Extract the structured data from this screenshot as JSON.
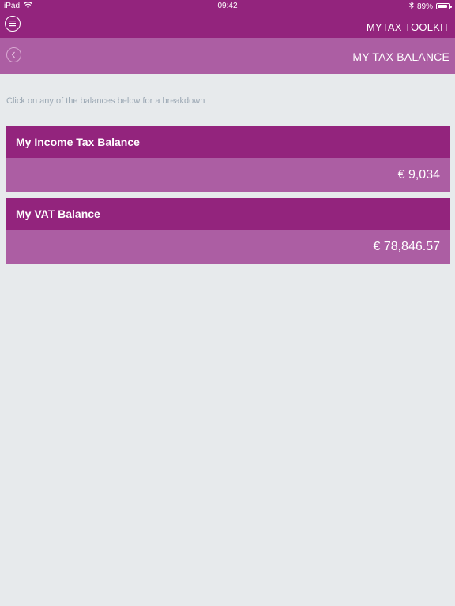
{
  "status_bar": {
    "device": "iPad",
    "time": "09:42",
    "battery": "89%",
    "battery_level": 0.89
  },
  "header": {
    "app_title": "MYTAX TOOLKIT",
    "menu_icon": "hamburger-menu-icon"
  },
  "subheader": {
    "page_title": "MY TAX BALANCE",
    "back_icon": "chevron-left-icon"
  },
  "hint": "Click on any of the balances below for a breakdown",
  "balances": [
    {
      "title": "My Income Tax Balance",
      "amount": "€ 9,034"
    },
    {
      "title": "My VAT Balance",
      "amount": "€ 78,846.57"
    }
  ],
  "colors": {
    "primary": "#93247d",
    "secondary": "#ac5ea3",
    "background": "#e7eaec"
  }
}
